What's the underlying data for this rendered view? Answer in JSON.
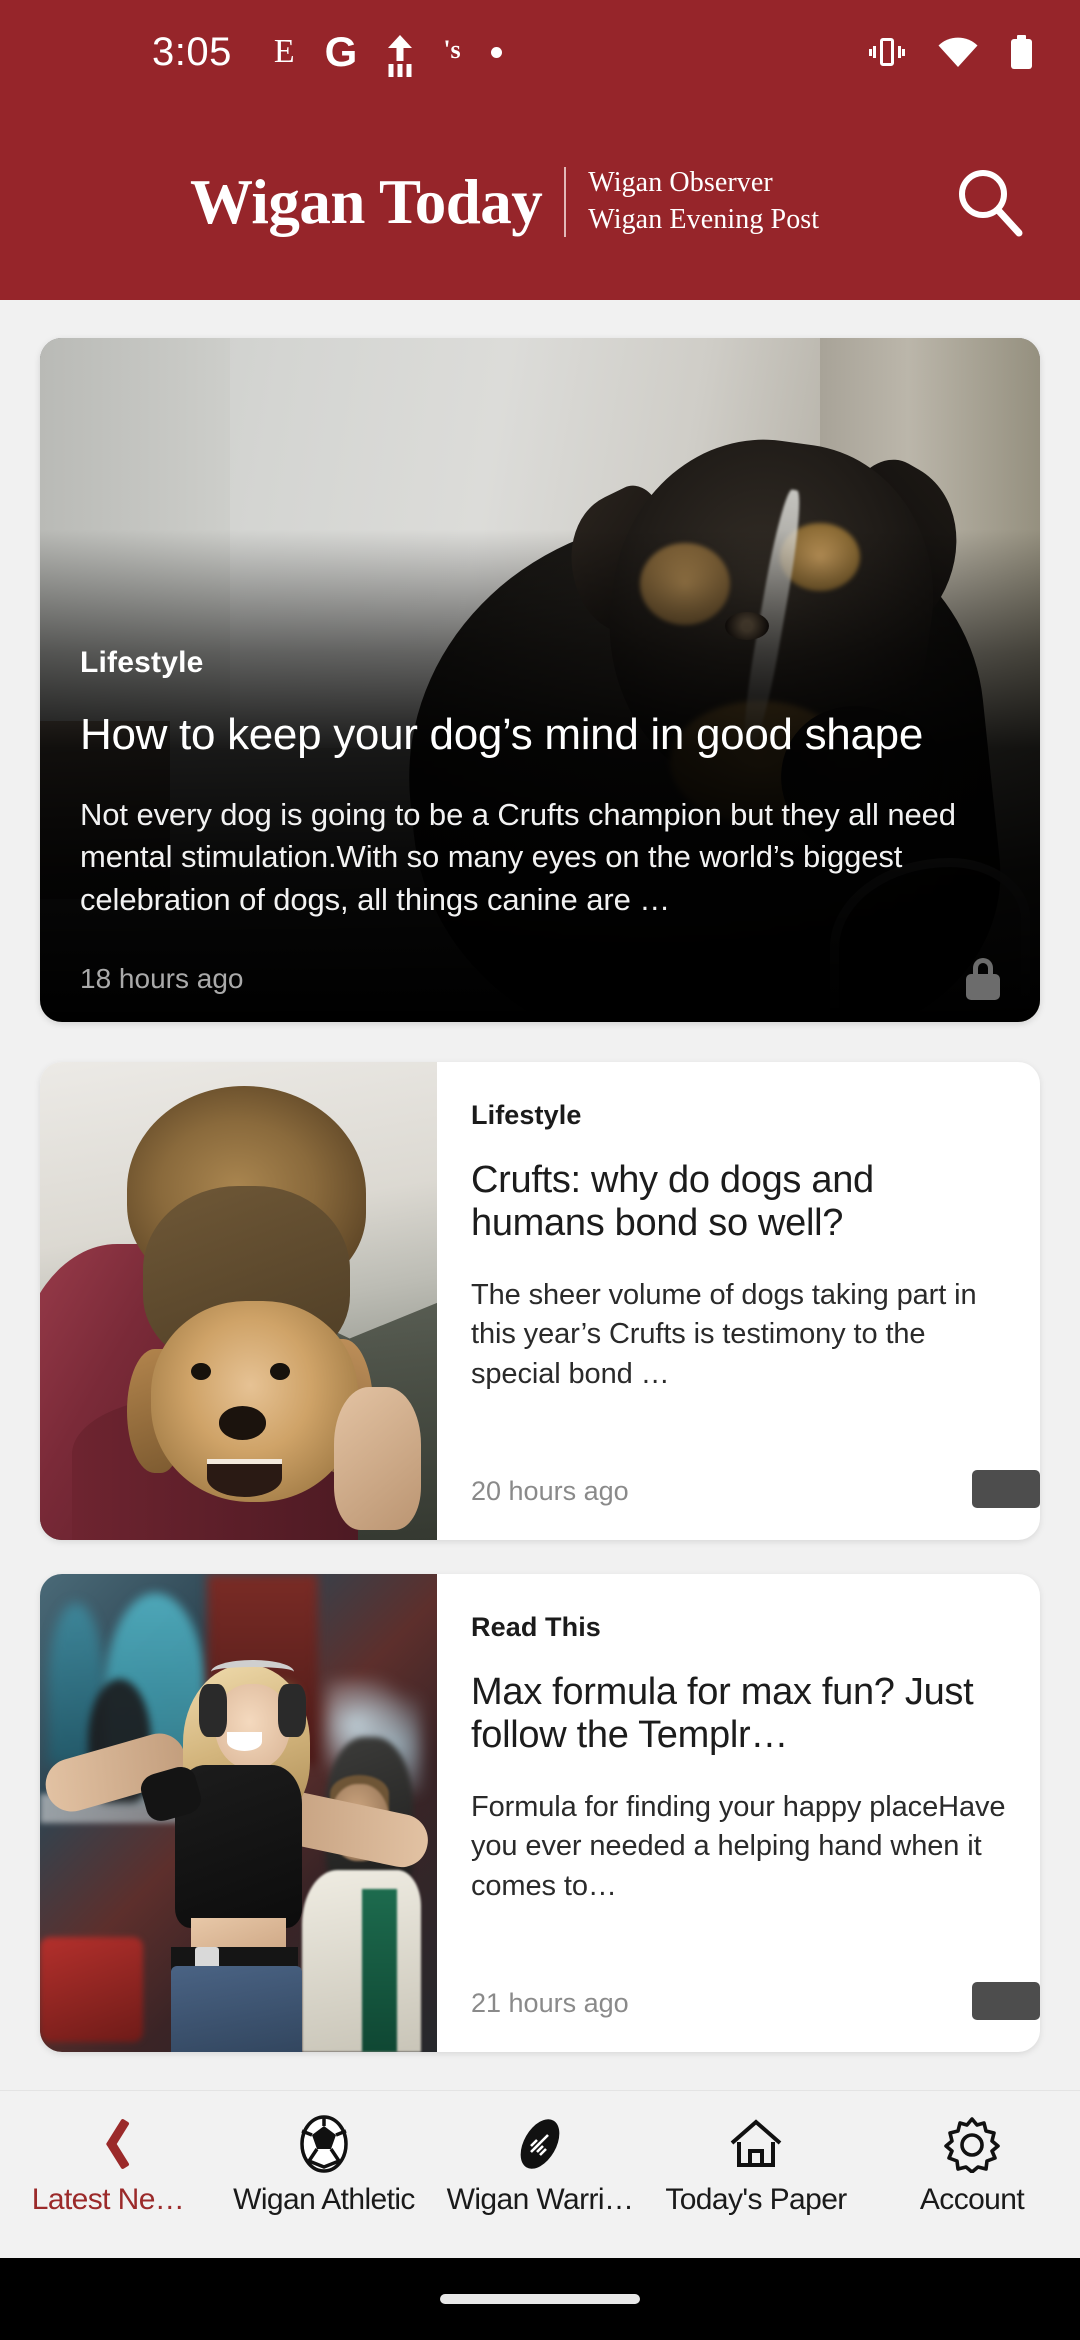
{
  "status_bar": {
    "time": "3:05",
    "notification_icons": [
      "email-icon",
      "google-icon",
      "upload-icon",
      "sainsburys-icon",
      "dot-icon"
    ],
    "system_icons": [
      "vibrate-icon",
      "wifi-icon",
      "battery-icon"
    ]
  },
  "header": {
    "brand_title": "Wigan Today",
    "subtitle_line1": "Wigan Observer",
    "subtitle_line2": "Wigan Evening Post",
    "search_icon": "search-icon",
    "background_color": "#96252a"
  },
  "feed": {
    "hero": {
      "kicker": "Lifestyle",
      "title": "How to keep your dog’s mind in good shape",
      "excerpt": "Not every dog is going to be a Crufts champion but they all need mental stimulation.With so many eyes on the world’s biggest celebration of dogs, all things canine are …",
      "timestamp": "18 hours ago",
      "premium_icon": "lock-icon",
      "image_alt": "black-and-tan-dog-indoors"
    },
    "articles": [
      {
        "kicker": "Lifestyle",
        "title": "Crufts: why do dogs and humans bond so well?",
        "excerpt": "The sheer volume of dogs taking part in this year’s Crufts is testimony to the special bond …",
        "timestamp": "20 hours ago",
        "premium_icon": "lock-icon",
        "image_alt": "boy-hugging-golden-retriever"
      },
      {
        "kicker": "Read This",
        "title": "Max formula for max fun? Just follow the Templr…",
        "excerpt": "Formula for finding your happy placeHave you ever needed a helping hand when it comes to…",
        "timestamp": "21 hours ago",
        "premium_icon": "lock-icon",
        "image_alt": "woman-dancing-with-headphones"
      }
    ]
  },
  "bottom_nav": {
    "active_index": 0,
    "active_color": "#9b2a2a",
    "items": [
      {
        "label": "Latest Ne…",
        "icon": "chevron-left-icon"
      },
      {
        "label": "Wigan Athletic",
        "icon": "soccer-ball-icon"
      },
      {
        "label": "Wigan Warri…",
        "icon": "rugby-ball-icon"
      },
      {
        "label": "Today's Paper",
        "icon": "home-icon"
      },
      {
        "label": "Account",
        "icon": "gear-icon"
      }
    ]
  }
}
